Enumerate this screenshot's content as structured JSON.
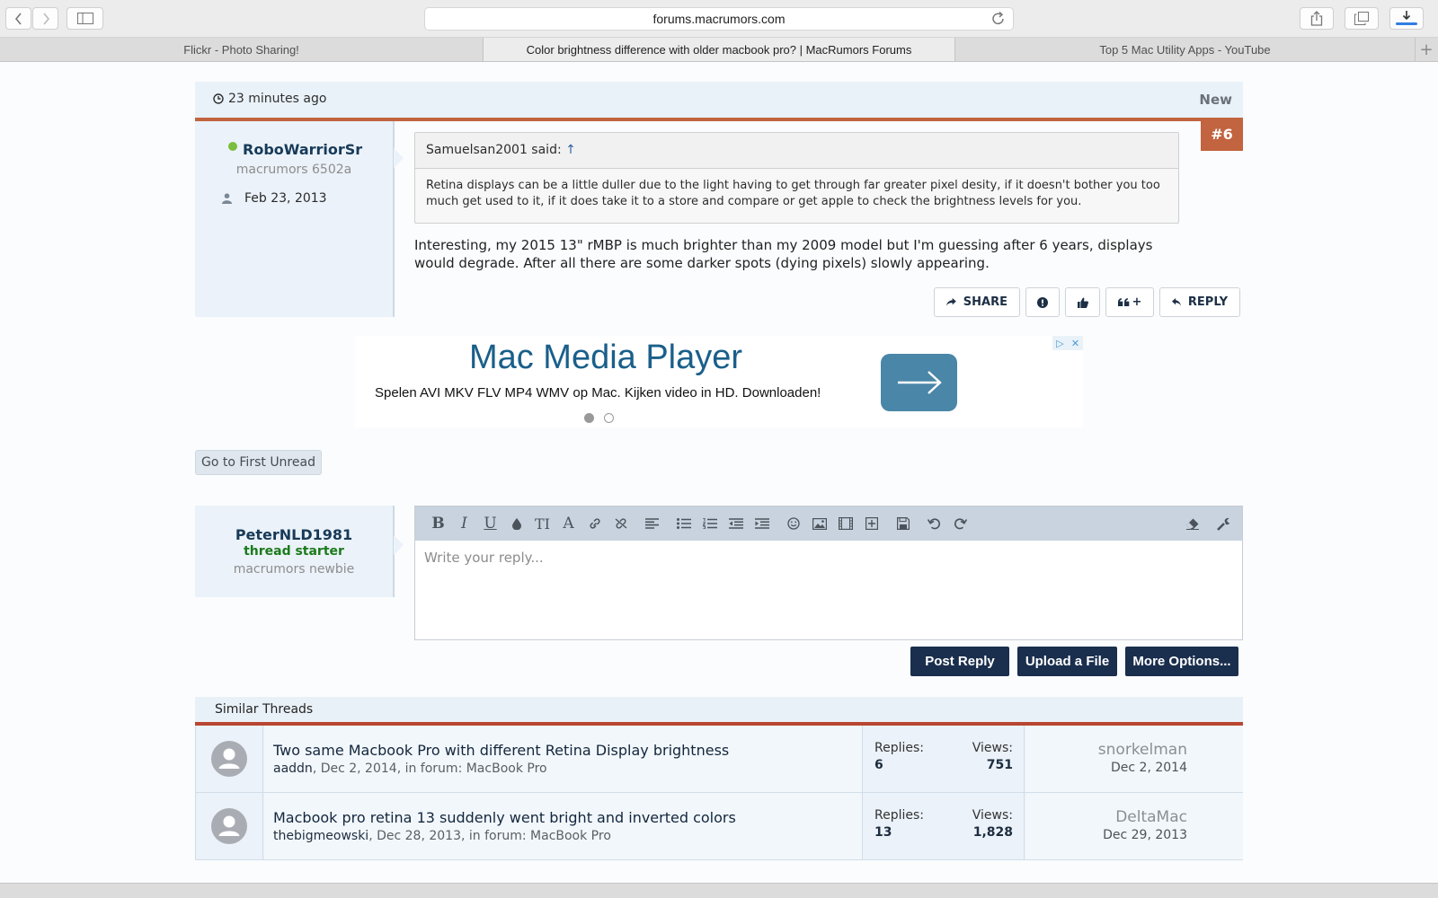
{
  "browser": {
    "url": "forums.macrumors.com",
    "tabs": [
      {
        "label": "Flickr - Photo Sharing!"
      },
      {
        "label": "Color brightness difference with older macbook pro? | MacRumors Forums"
      },
      {
        "label": "Top 5 Mac Utility Apps - YouTube"
      }
    ],
    "new_tab": "+"
  },
  "post": {
    "time": "23 minutes ago",
    "new_label": "New",
    "number": "#6",
    "user": {
      "name": "RoboWarriorSr",
      "title": "macrumors 6502a",
      "joined": "Feb 23, 2013"
    },
    "quote": {
      "author": "Samuelsan2001 said:",
      "arrow": "↑",
      "text": "Retina displays can be a little duller due to the light having to get through far greater pixel desity, if it doesn't bother you too much get used to it, if it does take it to a store and compare or get apple to check the brightness levels for you."
    },
    "text": "Interesting, my 2015 13\" rMBP is much brighter than my 2009 model but I'm guessing after 6 years, displays would degrade. After all there are some darker spots (dying pixels) slowly appearing.",
    "actions": {
      "share": "SHARE",
      "multiquote_plus": "+",
      "reply": "REPLY"
    }
  },
  "ad": {
    "title": "Mac Media Player",
    "text": "Spelen AVI MKV FLV MP4 WMV op Mac. Kijken video in HD. Downloaden!"
  },
  "first_unread": "Go to First Unread",
  "reply": {
    "user": {
      "name": "PeterNLD1981",
      "badge": "thread starter",
      "title": "macrumors newbie"
    },
    "placeholder": "Write your reply...",
    "buttons": {
      "post": "Post Reply",
      "upload": "Upload a File",
      "more": "More Options..."
    }
  },
  "similar": {
    "heading": "Similar Threads",
    "replies_label": "Replies:",
    "views_label": "Views:",
    "threads": [
      {
        "title": "Two same Macbook Pro with different Retina Display brightness",
        "author": "aaddn",
        "meta": ", Dec 2, 2014, in forum: MacBook Pro",
        "replies": "6",
        "views": "751",
        "last_user": "snorkelman",
        "last_date": "Dec 2, 2014"
      },
      {
        "title": "Macbook pro retina 13 suddenly went bright and inverted colors",
        "author": "thebigmeowski",
        "meta": ", Dec 28, 2013, in forum: MacBook Pro",
        "replies": "13",
        "views": "1,828",
        "last_user": "DeltaMac",
        "last_date": "Dec 29, 2013"
      }
    ]
  }
}
